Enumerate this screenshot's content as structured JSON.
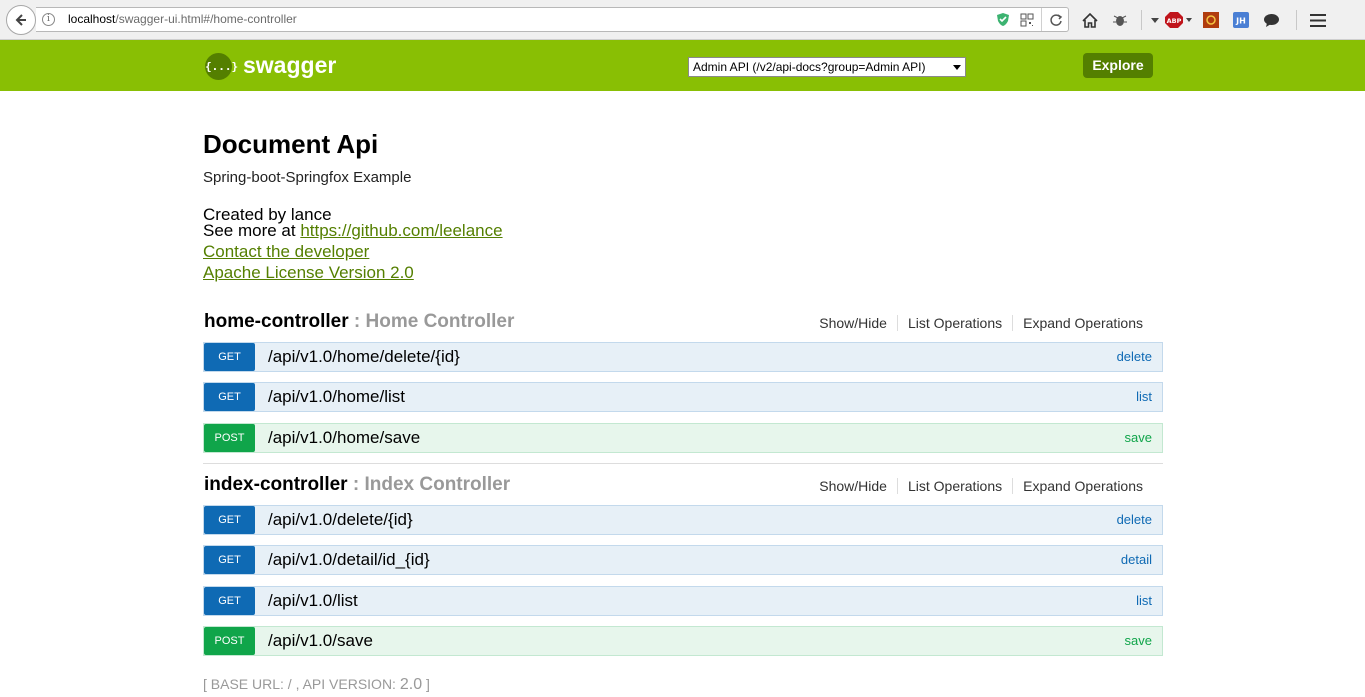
{
  "browser": {
    "url_host": "localhost",
    "url_path": "/swagger-ui.html#/home-controller"
  },
  "header": {
    "logo_glyph": "{...}",
    "title": "swagger",
    "api_select_value": "Admin API (/v2/api-docs?group=Admin API)",
    "explore_label": "Explore",
    "accent_color": "#89bf04"
  },
  "info": {
    "title": "Document Api",
    "description": "Spring-boot-Springfox Example",
    "created_by": "Created by lance",
    "see_more_prefix": "See more at ",
    "see_more_link": "https://github.com/leelance",
    "contact": "Contact the developer",
    "license": "Apache License Version 2.0"
  },
  "resources": [
    {
      "name": "home-controller",
      "description": " : Home Controller",
      "actions": [
        "Show/Hide",
        "List Operations",
        "Expand Operations"
      ],
      "operations": [
        {
          "method": "GET",
          "path": "/api/v1.0/home/delete/{id}",
          "summary": "delete"
        },
        {
          "method": "GET",
          "path": "/api/v1.0/home/list",
          "summary": "list"
        },
        {
          "method": "POST",
          "path": "/api/v1.0/home/save",
          "summary": "save"
        }
      ]
    },
    {
      "name": "index-controller",
      "description": " : Index Controller",
      "actions": [
        "Show/Hide",
        "List Operations",
        "Expand Operations"
      ],
      "operations": [
        {
          "method": "GET",
          "path": "/api/v1.0/delete/{id}",
          "summary": "delete"
        },
        {
          "method": "GET",
          "path": "/api/v1.0/detail/id_{id}",
          "summary": "detail"
        },
        {
          "method": "GET",
          "path": "/api/v1.0/list",
          "summary": "list"
        },
        {
          "method": "POST",
          "path": "/api/v1.0/save",
          "summary": "save"
        }
      ]
    }
  ],
  "footer": {
    "prefix": "[ BASE URL: / , API VERSION: ",
    "version": "2.0",
    "suffix": " ]"
  }
}
